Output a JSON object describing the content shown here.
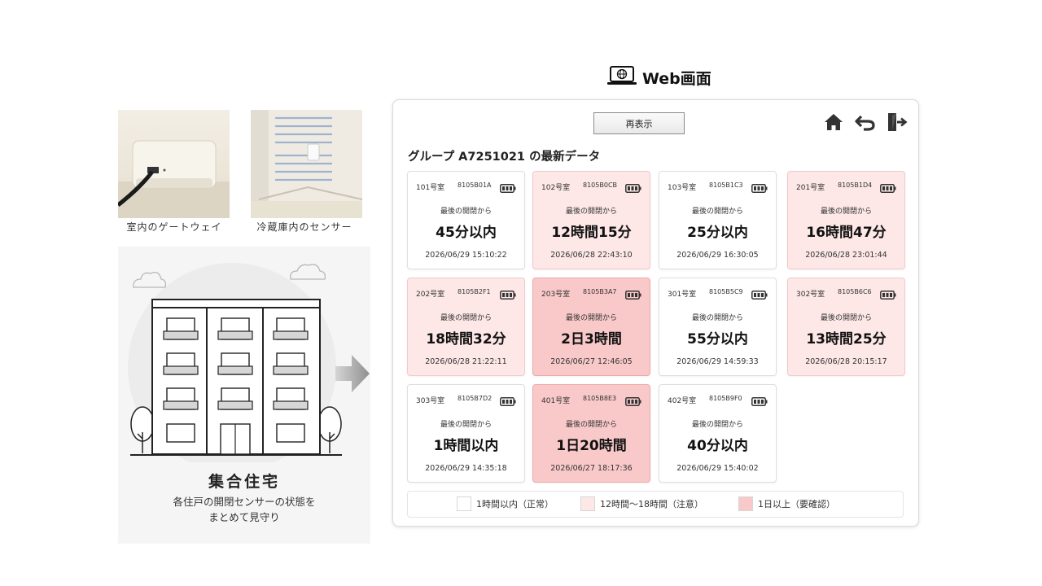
{
  "left": {
    "photos": [
      {
        "caption": "室内のゲートウェイ"
      },
      {
        "caption": "冷蔵庫内のセンサー"
      }
    ],
    "building_title": "集合住宅",
    "building_desc_line1": "各住戸の開閉センサーの状態を",
    "building_desc_line2": "まとめて見守り"
  },
  "web": {
    "label": "Web画面",
    "reload_label": "再表示",
    "group_title": "グループ A7251021 の最新データ",
    "nav_icons": [
      "home-icon",
      "back-icon",
      "logout-icon"
    ],
    "cards": [
      {
        "room": "101号室",
        "sensor_id": "8105B01A",
        "label": "最後の開閉から",
        "value": "45分以内",
        "timestamp": "2026/06/29 15:10:22",
        "status": "normal"
      },
      {
        "room": "102号室",
        "sensor_id": "8105B0CB",
        "label": "最後の開閉から",
        "value": "12時間15分",
        "timestamp": "2026/06/28 22:43:10",
        "status": "warning"
      },
      {
        "room": "103号室",
        "sensor_id": "8105B1C3",
        "label": "最後の開閉から",
        "value": "25分以内",
        "timestamp": "2026/06/29 16:30:05",
        "status": "normal"
      },
      {
        "room": "201号室",
        "sensor_id": "8105B1D4",
        "label": "最後の開閉から",
        "value": "16時間47分",
        "timestamp": "2026/06/28 23:01:44",
        "status": "warning"
      },
      {
        "room": "202号室",
        "sensor_id": "8105B2F1",
        "label": "最後の開閉から",
        "value": "18時間32分",
        "timestamp": "2026/06/28 21:22:11",
        "status": "warning"
      },
      {
        "room": "203号室",
        "sensor_id": "8105B3A7",
        "label": "最後の開閉から",
        "value": "2日3時間",
        "timestamp": "2026/06/27 12:46:05",
        "status": "alert"
      },
      {
        "room": "301号室",
        "sensor_id": "8105B5C9",
        "label": "最後の開閉から",
        "value": "55分以内",
        "timestamp": "2026/06/29 14:59:33",
        "status": "normal"
      },
      {
        "room": "302号室",
        "sensor_id": "8105B6C6",
        "label": "最後の開閉から",
        "value": "13時間25分",
        "timestamp": "2026/06/28 20:15:17",
        "status": "warning"
      },
      {
        "room": "303号室",
        "sensor_id": "8105B7D2",
        "label": "最後の開閉から",
        "value": "1時間以内",
        "timestamp": "2026/06/29 14:35:18",
        "status": "normal"
      },
      {
        "room": "401号室",
        "sensor_id": "8105B8E3",
        "label": "最後の開閉から",
        "value": "1日20時間",
        "timestamp": "2026/06/27 18:17:36",
        "status": "alert"
      },
      {
        "room": "402号室",
        "sensor_id": "8105B9F0",
        "label": "最後の開閉から",
        "value": "40分以内",
        "timestamp": "2026/06/29 15:40:02",
        "status": "normal"
      }
    ],
    "legend": [
      {
        "label": "1時間以内（正常）",
        "color": "#ffffff"
      },
      {
        "label": "12時間〜18時間（注意）",
        "color": "#fde7e7"
      },
      {
        "label": "1日以上（要確認）",
        "color": "#f9c9c9"
      }
    ]
  }
}
